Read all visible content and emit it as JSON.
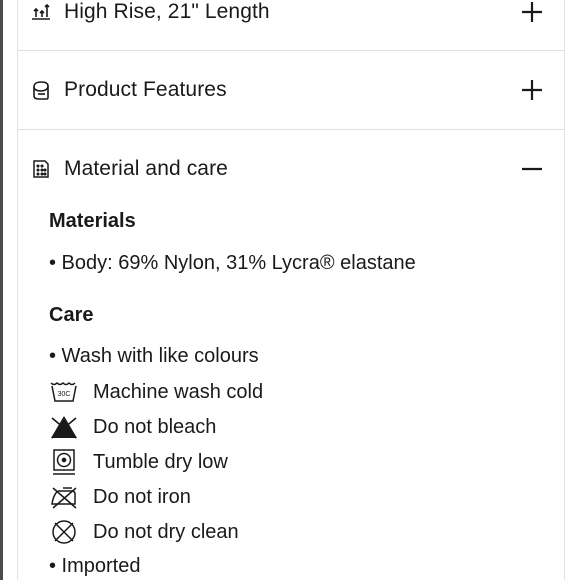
{
  "accordion": {
    "rise": {
      "label": "High Rise, 21\" Length",
      "icon": "measure-arrows-icon",
      "toggle": "plus-icon"
    },
    "features": {
      "label": "Product Features",
      "icon": "fabric-roll-icon",
      "toggle": "plus-icon"
    },
    "material": {
      "label": "Material and care",
      "icon": "fabric-swatch-icon",
      "toggle": "minus-icon"
    }
  },
  "materials": {
    "heading": "Materials",
    "items": [
      "• Body: 69% Nylon, 31% Lycra® elastane"
    ]
  },
  "care": {
    "heading": "Care",
    "bullet_top": "• Wash with like colours",
    "instructions": [
      {
        "label": "Machine wash cold",
        "icon": "wash-30c-icon"
      },
      {
        "label": "Do not bleach",
        "icon": "no-bleach-icon"
      },
      {
        "label": "Tumble dry low",
        "icon": "tumble-dry-low-icon"
      },
      {
        "label": "Do not iron",
        "icon": "no-iron-icon"
      },
      {
        "label": "Do not dry clean",
        "icon": "no-dry-clean-icon"
      }
    ],
    "bullet_bottom": "• Imported"
  }
}
